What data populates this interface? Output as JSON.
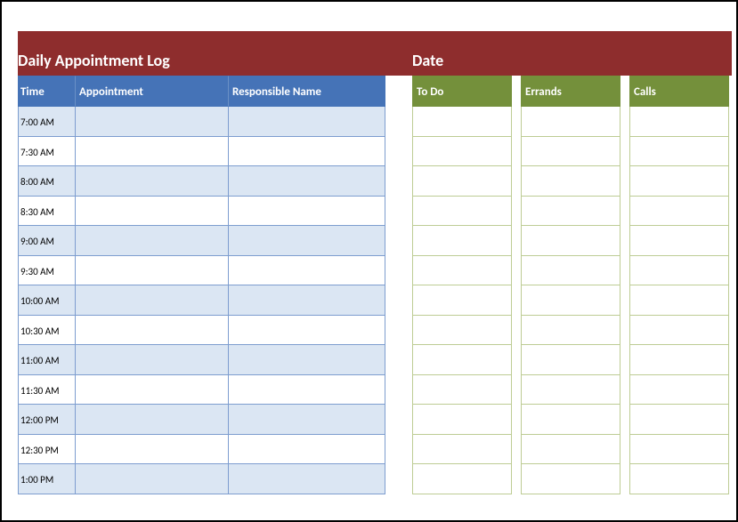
{
  "banner": {
    "title_left": "Daily Appointment Log",
    "title_right": "Date"
  },
  "appointment_table": {
    "headers": {
      "time": "Time",
      "appointment": "Appointment",
      "responsible": "Responsible Name"
    },
    "rows": [
      {
        "time": "7:00 AM",
        "appointment": "",
        "responsible": ""
      },
      {
        "time": "7:30 AM",
        "appointment": "",
        "responsible": ""
      },
      {
        "time": "8:00 AM",
        "appointment": "",
        "responsible": ""
      },
      {
        "time": "8:30 AM",
        "appointment": "",
        "responsible": ""
      },
      {
        "time": "9:00 AM",
        "appointment": "",
        "responsible": ""
      },
      {
        "time": "9:30 AM",
        "appointment": "",
        "responsible": ""
      },
      {
        "time": "10:00 AM",
        "appointment": "",
        "responsible": ""
      },
      {
        "time": "10:30 AM",
        "appointment": "",
        "responsible": ""
      },
      {
        "time": "11:00 AM",
        "appointment": "",
        "responsible": ""
      },
      {
        "time": "11:30 AM",
        "appointment": "",
        "responsible": ""
      },
      {
        "time": "12:00 PM",
        "appointment": "",
        "responsible": ""
      },
      {
        "time": "12:30 PM",
        "appointment": "",
        "responsible": ""
      },
      {
        "time": "1:00 PM",
        "appointment": "",
        "responsible": ""
      }
    ]
  },
  "side_columns": {
    "todo": {
      "header": "To Do",
      "rows": [
        "",
        "",
        "",
        "",
        "",
        "",
        "",
        "",
        "",
        "",
        "",
        "",
        ""
      ]
    },
    "errands": {
      "header": "Errands",
      "rows": [
        "",
        "",
        "",
        "",
        "",
        "",
        "",
        "",
        "",
        "",
        "",
        "",
        ""
      ]
    },
    "calls": {
      "header": "Calls",
      "rows": [
        "",
        "",
        "",
        "",
        "",
        "",
        "",
        "",
        "",
        "",
        "",
        "",
        ""
      ]
    }
  }
}
